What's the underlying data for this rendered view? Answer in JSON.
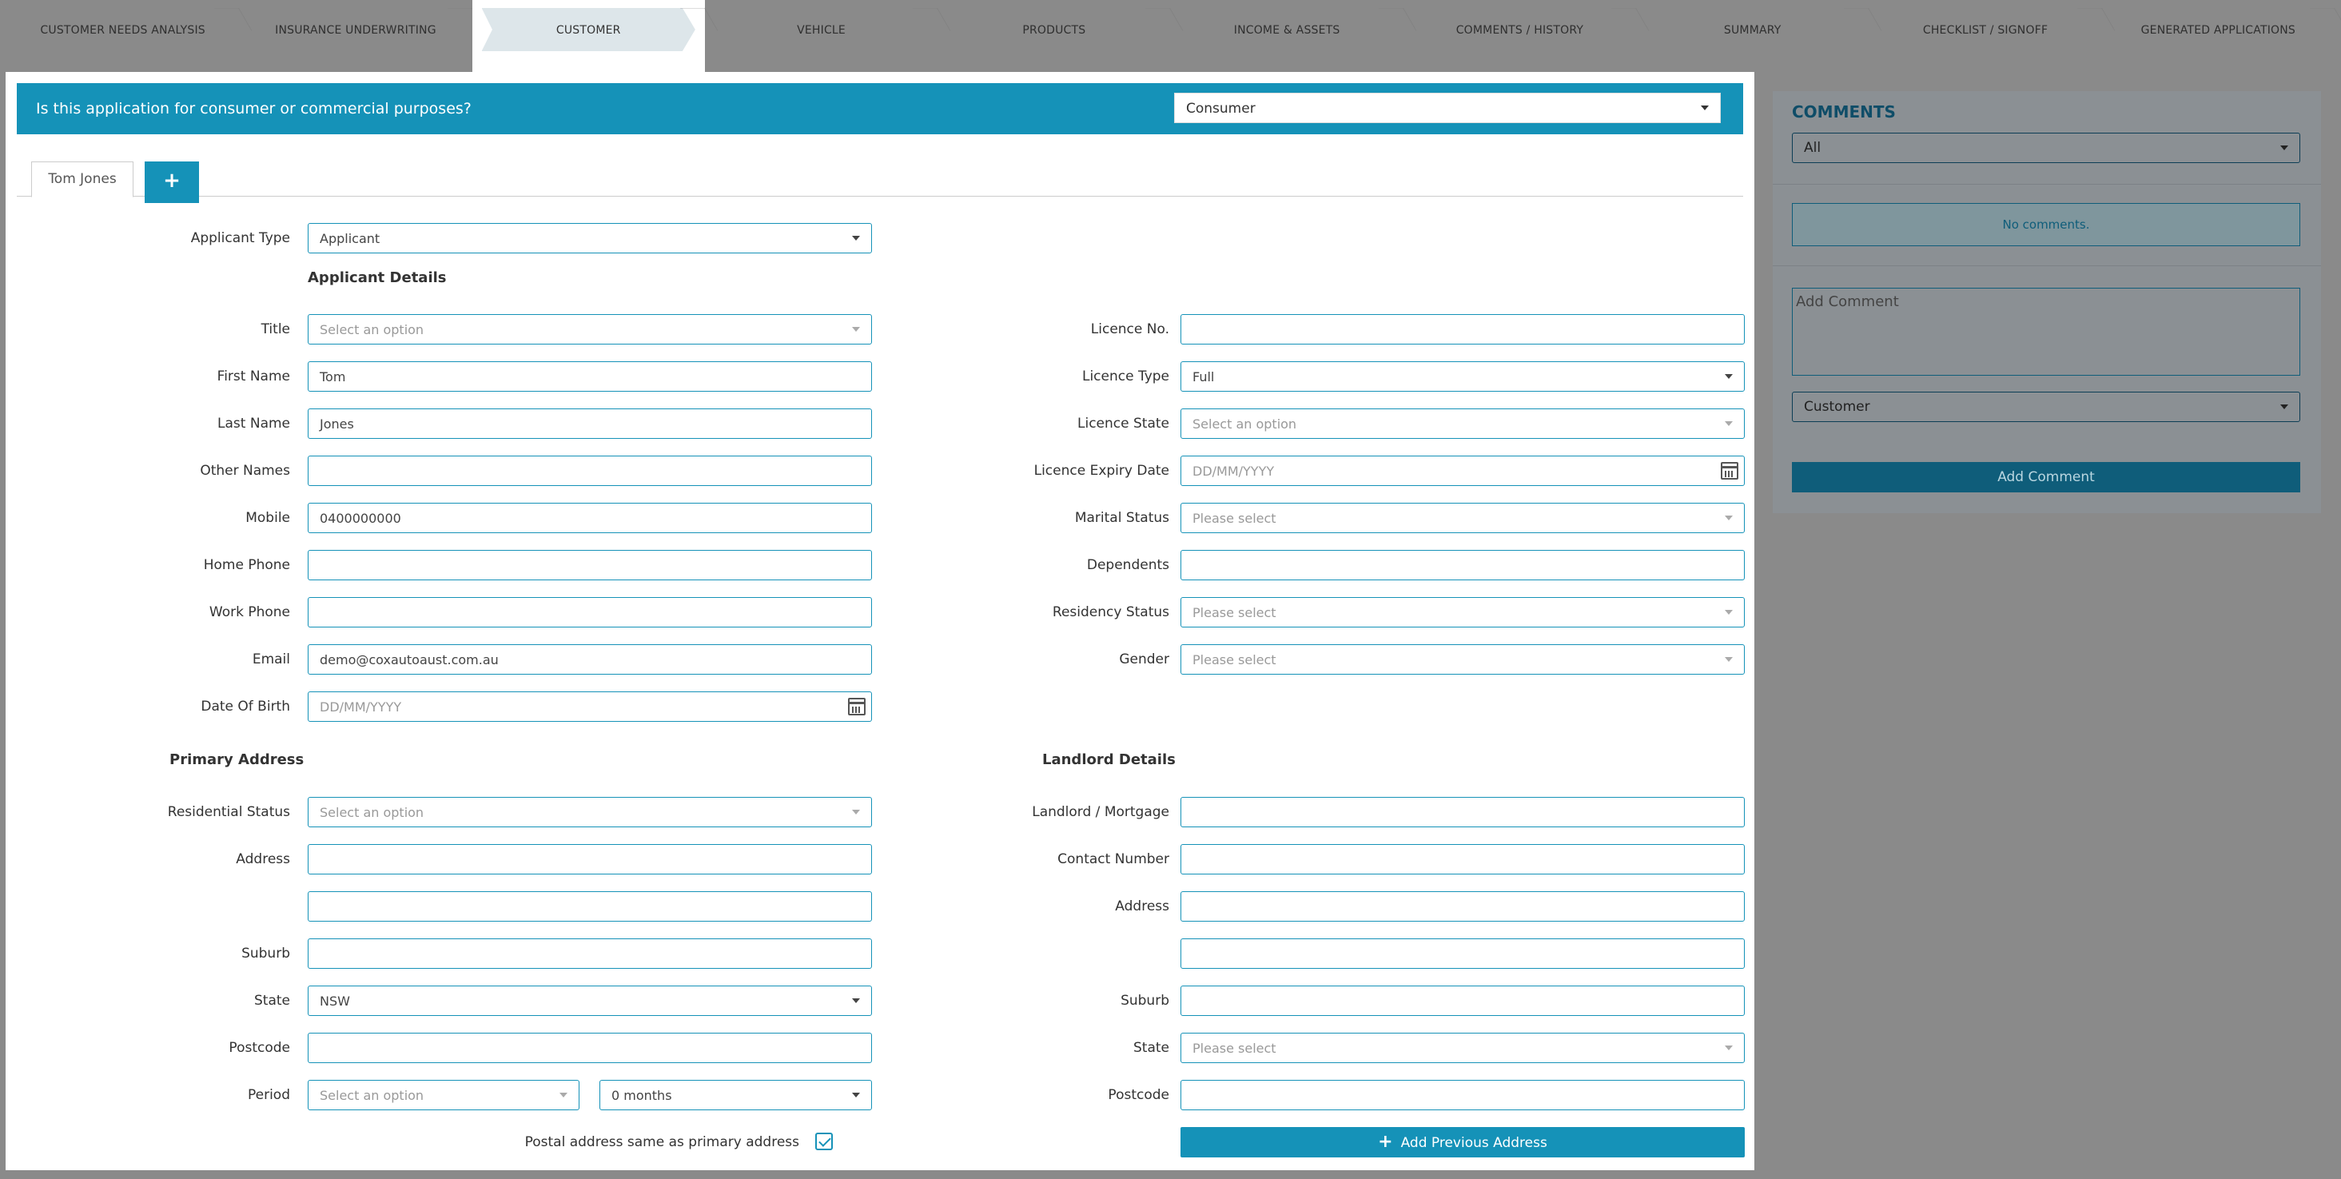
{
  "steps": [
    {
      "label": "CUSTOMER NEEDS ANALYSIS"
    },
    {
      "label": "INSURANCE UNDERWRITING"
    },
    {
      "label": "CUSTOMER"
    },
    {
      "label": "VEHICLE"
    },
    {
      "label": "PRODUCTS"
    },
    {
      "label": "INCOME & ASSETS"
    },
    {
      "label": "COMMENTS / HISTORY"
    },
    {
      "label": "SUMMARY"
    },
    {
      "label": "CHECKLIST / SIGNOFF"
    },
    {
      "label": "GENERATED APPLICATIONS"
    }
  ],
  "banner": {
    "question": "Is this application for consumer or commercial purposes?",
    "purpose": "Consumer"
  },
  "tabs": {
    "applicant_tab": "Tom Jones",
    "add_symbol": "+"
  },
  "form": {
    "applicant_type_label": "Applicant Type",
    "applicant_type": "Applicant",
    "applicant_details_heading": "Applicant Details",
    "title_label": "Title",
    "title_ph": "Select an option",
    "first_name_label": "First Name",
    "first_name": "Tom",
    "last_name_label": "Last Name",
    "last_name": "Jones",
    "other_names_label": "Other Names",
    "mobile_label": "Mobile",
    "mobile": "0400000000",
    "home_phone_label": "Home Phone",
    "work_phone_label": "Work Phone",
    "email_label": "Email",
    "email": "demo@coxautoaust.com.au",
    "dob_label": "Date Of Birth",
    "dob_ph": "DD/MM/YYYY",
    "licence_no_label": "Licence No.",
    "licence_type_label": "Licence Type",
    "licence_type": "Full",
    "licence_state_label": "Licence State",
    "licence_state_ph": "Select an option",
    "licence_expiry_label": "Licence Expiry Date",
    "licence_expiry_ph": "DD/MM/YYYY",
    "marital_label": "Marital Status",
    "marital_ph": "Please select",
    "dependents_label": "Dependents",
    "residency_label": "Residency Status",
    "residency_ph": "Please select",
    "gender_label": "Gender",
    "gender_ph": "Please select",
    "primary_address_heading": "Primary Address",
    "res_status_label": "Residential Status",
    "res_status_ph": "Select an option",
    "address_label": "Address",
    "suburb_label": "Suburb",
    "state_label": "State",
    "state": "NSW",
    "postcode_label": "Postcode",
    "period_label": "Period",
    "period_ph": "Select an option",
    "period_months": "0 months",
    "postal_same_label": "Postal address same as primary address",
    "landlord_heading": "Landlord Details",
    "landlord_label": "Landlord / Mortgage",
    "contact_label": "Contact Number",
    "ll_address_label": "Address",
    "ll_suburb_label": "Suburb",
    "ll_state_label": "State",
    "ll_state_ph": "Please select",
    "ll_postcode_label": "Postcode",
    "add_prev_address": "Add Previous Address"
  },
  "comments": {
    "heading": "COMMENTS",
    "filter": "All",
    "empty": "No comments.",
    "add_placeholder": "Add Comment",
    "category": "Customer",
    "add_button": "Add Comment"
  }
}
